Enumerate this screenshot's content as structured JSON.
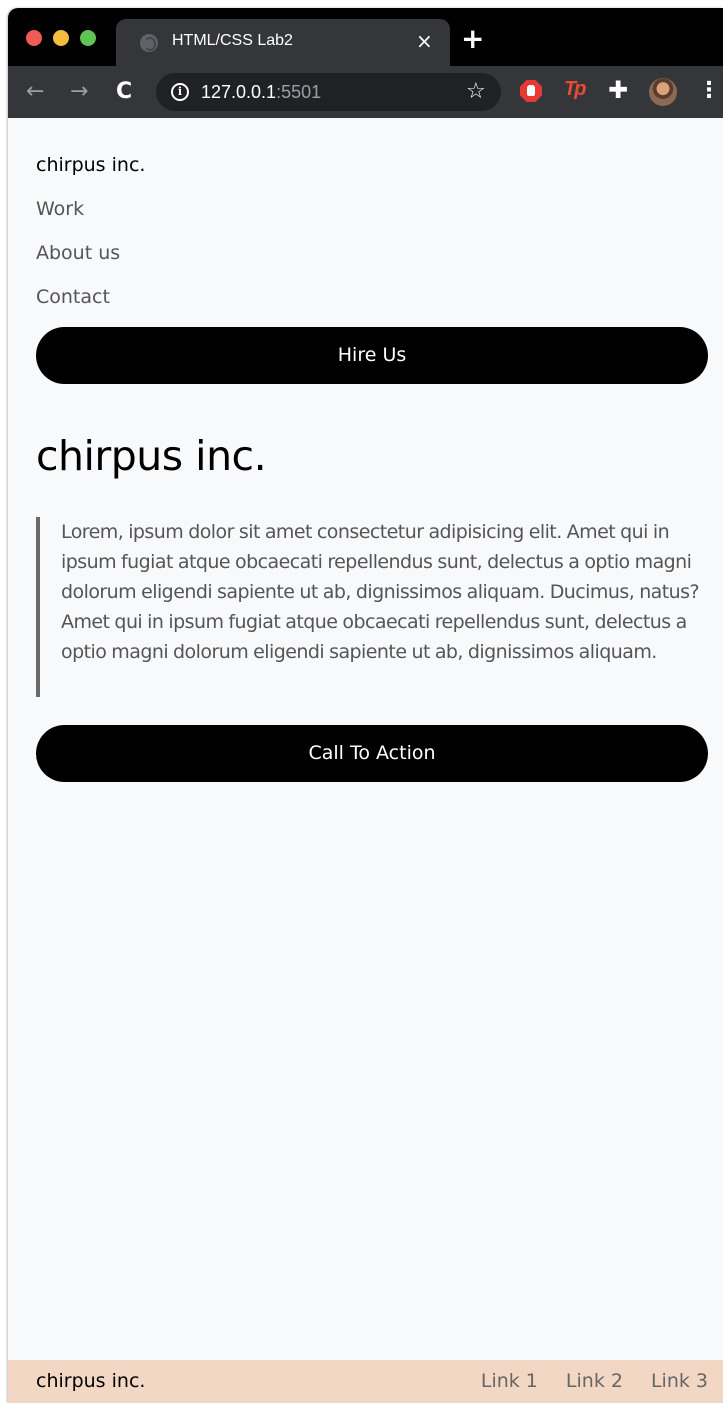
{
  "browser": {
    "tab_title": "HTML/CSS Lab2",
    "tab_close": "×",
    "new_tab": "+",
    "url_host": "127.0.0.1",
    "url_port": ":5501",
    "icons": {
      "back": "←",
      "forward": "→",
      "reload": "C",
      "info": "i",
      "star": "☆",
      "puzzle": "✚",
      "menu": "⋮",
      "tp_extension": "Tp"
    }
  },
  "nav": {
    "brand": "chirpus inc.",
    "links": [
      "Work",
      "About us",
      "Contact"
    ],
    "hire_button": "Hire Us"
  },
  "hero": {
    "title": "chirpus inc.",
    "quote": "Lorem, ipsum dolor sit amet consectetur adipisicing elit. Amet qui in ipsum fugiat atque obcaecati repellendus sunt, delectus a optio magni dolorum eligendi sapiente ut ab, dignissimos aliquam. Ducimus, natus? Amet qui in ipsum fugiat atque obcaecati repellendus sunt, delectus a optio magni dolorum eligendi sapiente ut ab, dignissimos aliquam.",
    "cta_button": "Call To Action"
  },
  "footer": {
    "brand": "chirpus inc.",
    "links": [
      "Link 1",
      "Link 2",
      "Link 3"
    ]
  },
  "colors": {
    "page_background": "#f8f9fb",
    "footer_background": "#f3d7c5",
    "button_background": "#000000",
    "muted_text": "#555555"
  }
}
